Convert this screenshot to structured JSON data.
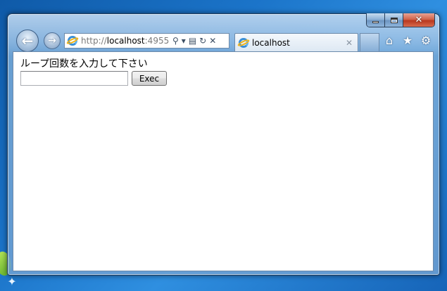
{
  "browser": {
    "url_prefix": "http://",
    "url_host": "localhost",
    "url_suffix": ":4955",
    "tab_title": "localhost",
    "icons": {
      "back": "back-arrow-icon",
      "forward": "forward-arrow-icon",
      "search": "search-icon",
      "compat": "compatibility-view-icon",
      "refresh": "refresh-icon",
      "stop": "stop-icon",
      "home": "home-icon",
      "favorites": "star-icon",
      "tools": "gear-icon"
    }
  },
  "page": {
    "prompt": "ループ回数を入力して下さい",
    "input_value": "",
    "exec_label": "Exec"
  }
}
